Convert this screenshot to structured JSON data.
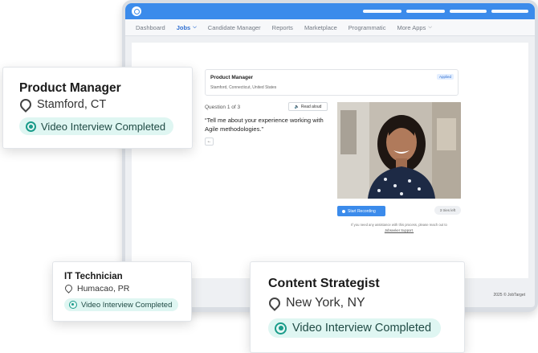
{
  "nav": {
    "items": [
      {
        "label": "Dashboard",
        "active": false,
        "has_caret": false
      },
      {
        "label": "Jobs",
        "active": true,
        "has_caret": true
      },
      {
        "label": "Candidate Manager",
        "active": false,
        "has_caret": false
      },
      {
        "label": "Reports",
        "active": false,
        "has_caret": false
      },
      {
        "label": "Marketplace",
        "active": false,
        "has_caret": false
      },
      {
        "label": "Programmatic",
        "active": false,
        "has_caret": false
      },
      {
        "label": "More Apps",
        "active": false,
        "has_caret": true
      }
    ],
    "caret_icon": "chevron-down-icon"
  },
  "job": {
    "title": "Product Manager",
    "location": "Stamford, Connecticut, United States",
    "status_badge": "Applied"
  },
  "interview": {
    "question_count": "Question 1 of 3",
    "read_aloud_label": "Read aloud",
    "question_text": "“Tell me about your experience working with Agile methodologies.”",
    "back_icon": "arrow-left-icon",
    "record_label": "Start Recording",
    "tries_left": "3 tries left",
    "help_text": "If you need any assistance with this process, please reach out to",
    "help_link": "Jobseeker Support."
  },
  "footer": {
    "copyright": "2025 © JobTarget"
  },
  "cards": [
    {
      "title": "Product Manager",
      "location": "Stamford, CT",
      "status": "Video Interview Completed"
    },
    {
      "title": "IT Technician",
      "location": "Humacao, PR",
      "status": "Video Interview Completed"
    },
    {
      "title": "Content Strategist",
      "location": "New York, NY",
      "status": "Video Interview Completed"
    }
  ],
  "colors": {
    "brand_blue": "#3b8beb",
    "badge_bg": "#dff6f2",
    "badge_accent": "#1a9c8a"
  }
}
